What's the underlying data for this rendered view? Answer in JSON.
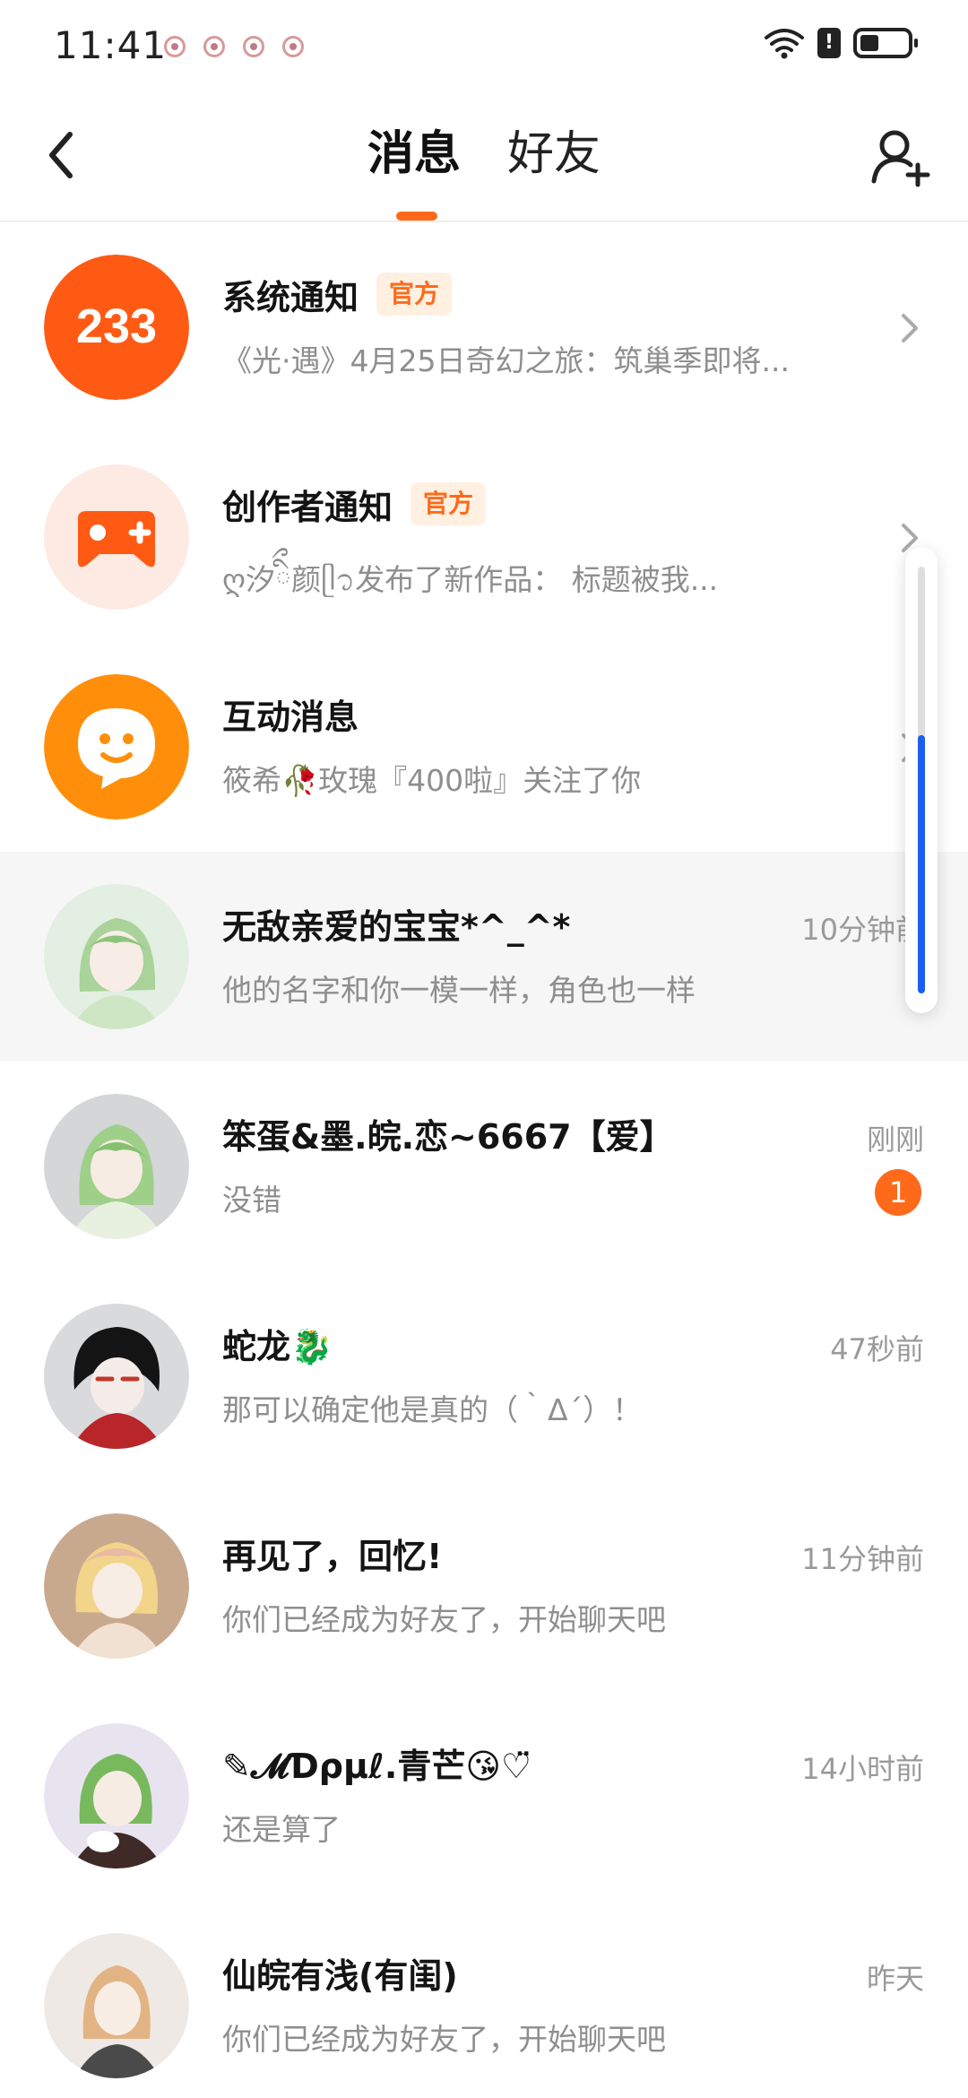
{
  "status_bar": {
    "time": "11:41",
    "alert_symbol": "!"
  },
  "header": {
    "tabs": [
      {
        "label": "消息",
        "active": true
      },
      {
        "label": "好友",
        "active": false
      }
    ],
    "accent_color": "#ff6a1a"
  },
  "messages": [
    {
      "name": "系统通知",
      "badge": "官方",
      "preview": "《光·遇》4月25日奇幻之旅：筑巢季即将...",
      "avatar_text": "233",
      "icon": "system-notice-icon"
    },
    {
      "name": "创作者通知",
      "badge": "官方",
      "preview": "ღ汐ིྀ颜ᥫ᭡发布了新作品： 标题被我...",
      "icon": "gamepad-icon"
    },
    {
      "name": "互动消息",
      "preview": "筱希🥀玫瑰『400啦』关注了你",
      "icon": "chat-bubble-icon"
    },
    {
      "name": "无敌亲爱的宝宝*^_^*",
      "preview": "他的名字和你一模一样，角色也一样",
      "time": "10分钟前"
    },
    {
      "name": "笨蛋&墨.皖.恋~6667【爱】",
      "preview": "没错",
      "time": "刚刚",
      "unread": "1"
    },
    {
      "name": "蛇龙🐉",
      "preview": "那可以确定他是真的（｀Δ´）！",
      "time": "47秒前"
    },
    {
      "name": "再见了，回忆!",
      "preview": "你们已经成为好友了，开始聊天吧",
      "time": "11分钟前"
    },
    {
      "name": "✎𝓜Ɗρµℓ.青芒😘♡̈",
      "preview": "还是算了",
      "time": "14小时前"
    },
    {
      "name": "仙皖有浅(有闺)",
      "preview": "你们已经成为好友了，开始聊天吧",
      "time": "昨天"
    }
  ],
  "scroll": {
    "thumb_fraction": 0.6
  }
}
